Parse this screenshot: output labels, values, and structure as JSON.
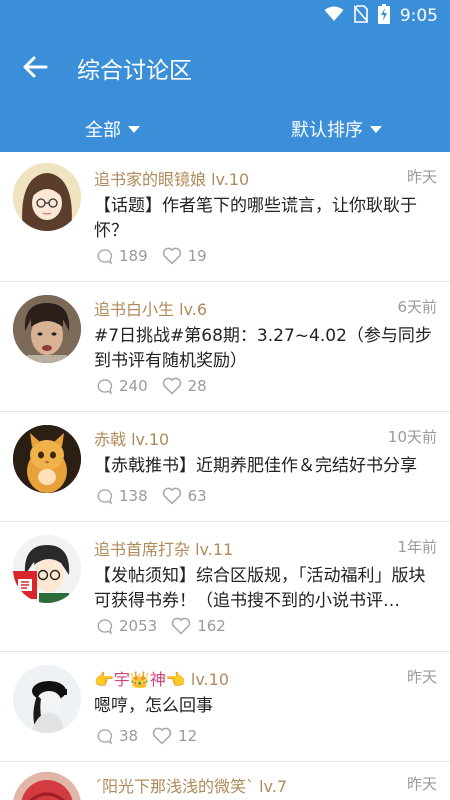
{
  "status_bar": {
    "time": "9:05"
  },
  "header": {
    "title": "综合讨论区"
  },
  "filters": {
    "category": "全部",
    "sort": "默认排序"
  },
  "posts": [
    {
      "user": "追书家的眼镜娘",
      "level": "lv.10",
      "time": "昨天",
      "text": "【话题】作者笔下的哪些谎言，让你耿耿于怀？",
      "comments": "189",
      "likes": "19"
    },
    {
      "user": "追书白小生",
      "level": "lv.6",
      "time": "6天前",
      "text": "#7日挑战#第68期：3.27~4.02（参与同步到书评有随机奖励）",
      "comments": "240",
      "likes": "28"
    },
    {
      "user": "赤戟",
      "level": "lv.10",
      "time": "10天前",
      "text": "【赤戟推书】近期养肥佳作＆完结好书分享",
      "comments": "138",
      "likes": "63"
    },
    {
      "user": "追书首席打杂",
      "level": "lv.11",
      "time": "1年前",
      "text": "【发帖须知】综合区版规，「活动福利」版块可获得书券！（追书搜不到的小说书评…",
      "comments": "2053",
      "likes": "162"
    },
    {
      "user": "👉宇👑神👈",
      "level": "lv.10",
      "time": "昨天",
      "text": "嗯哼，怎么回事",
      "comments": "38",
      "likes": "12"
    },
    {
      "user": "ˊ阳光下那浅浅的微笑ˋ",
      "level": "lv.7",
      "time": "昨天",
      "text": "",
      "comments": "",
      "likes": ""
    }
  ]
}
